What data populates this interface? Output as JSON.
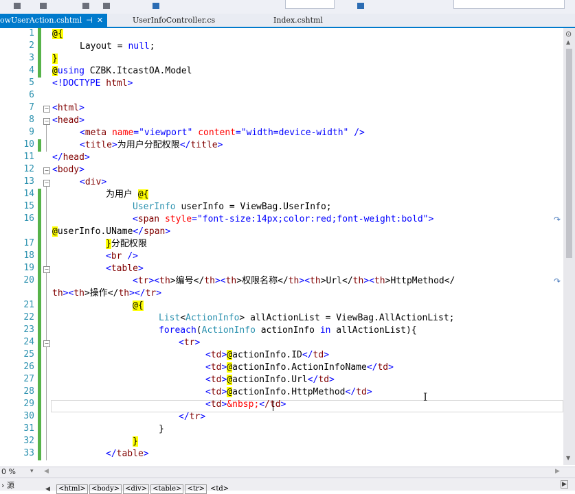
{
  "tabs": [
    {
      "label": "owUserAction.cshtml",
      "active": true,
      "pin": "⊣",
      "close": "✕"
    },
    {
      "label": "UserInfoController.cs",
      "active": false
    },
    {
      "label": "Index.cshtml",
      "active": false
    }
  ],
  "editor": {
    "line_numbers": [
      "1",
      "2",
      "3",
      "4",
      "5",
      "6",
      "7",
      "8",
      "9",
      "10",
      "11",
      "12",
      "13",
      "14",
      "15",
      "16",
      "17",
      "18",
      "19",
      "20",
      "21",
      "22",
      "23",
      "24",
      "25",
      "26",
      "27",
      "28",
      "29",
      "30",
      "31",
      "32",
      "33"
    ],
    "lines": {
      "l1": [
        "@{"
      ],
      "l2": [
        "Layout ",
        "= ",
        "null",
        ";"
      ],
      "l3": [
        "}"
      ],
      "l4": [
        "@",
        "using",
        " CZBK.ItcastOA.Model"
      ],
      "l5": [
        "<!DOCTYPE ",
        "html",
        ">"
      ],
      "l7": [
        "<",
        "html",
        ">"
      ],
      "l8": [
        "<",
        "head",
        ">"
      ],
      "l9": [
        "<",
        "meta ",
        "name",
        "=",
        "\"viewport\"",
        " ",
        "content",
        "=",
        "\"width=device-width\"",
        " />"
      ],
      "l10": [
        "<",
        "title",
        ">",
        "为用户分配权限",
        "</",
        "title",
        ">"
      ],
      "l11": [
        "</",
        "head",
        ">"
      ],
      "l12": [
        "<",
        "body",
        ">"
      ],
      "l13": [
        "<",
        "div",
        ">"
      ],
      "l14": [
        "为用户 ",
        "@{"
      ],
      "l15": [
        "UserInfo",
        " userInfo = ViewBag.UserInfo;"
      ],
      "l16a": [
        "<",
        "span ",
        "style",
        "=",
        "\"font-size:14px;color:red;font-weight:bold\"",
        ">"
      ],
      "l16b": [
        "@",
        "userInfo.UName",
        "</",
        "span",
        ">"
      ],
      "l17": [
        "}",
        "分配权限"
      ],
      "l18": [
        "<",
        "br ",
        "/>"
      ],
      "l19": [
        "<",
        "table",
        ">"
      ],
      "l20a": [
        "<",
        "tr",
        "><",
        "th",
        ">编号</",
        "th",
        "><",
        "th",
        ">权限名称</",
        "th",
        "><",
        "th",
        ">Url</",
        "th",
        "><",
        "th",
        ">HttpMethod</"
      ],
      "l20b": [
        "th",
        "><",
        "th",
        ">操作</",
        "th",
        "></",
        "tr",
        ">"
      ],
      "l21": [
        "@{"
      ],
      "l22": [
        "List",
        "<",
        "ActionInfo",
        "> allActionList = ViewBag.AllActionList;"
      ],
      "l23": [
        "foreach",
        "(",
        "ActionInfo",
        " actionInfo ",
        "in",
        " allActionList){"
      ],
      "l24": [
        "<",
        "tr",
        ">"
      ],
      "l25": [
        "<",
        "td",
        ">",
        "@",
        "actionInfo.ID",
        "</",
        "td",
        ">"
      ],
      "l26": [
        "<",
        "td",
        ">",
        "@",
        "actionInfo.ActionInfoName",
        "</",
        "td",
        ">"
      ],
      "l27": [
        "<",
        "td",
        ">",
        "@",
        "actionInfo.Url",
        "</",
        "td",
        ">"
      ],
      "l28": [
        "<",
        "td",
        ">",
        "@",
        "actionInfo.HttpMethod",
        "</",
        "td",
        ">"
      ],
      "l29": [
        "<",
        "td",
        ">",
        "&nbsp;",
        "<",
        "/td",
        ">"
      ],
      "l30": [
        "</",
        "tr",
        ">"
      ],
      "l31": [
        "}"
      ],
      "l32": [
        "}"
      ],
      "l33": [
        "</",
        "table",
        ">"
      ]
    }
  },
  "status": {
    "zoom": "0 %",
    "zoom_arrow": "▾",
    "source_label": "› 源",
    "crumbs": [
      "<html>",
      "<body>",
      "<div>",
      "<table>",
      "<tr>",
      "<td>"
    ]
  }
}
